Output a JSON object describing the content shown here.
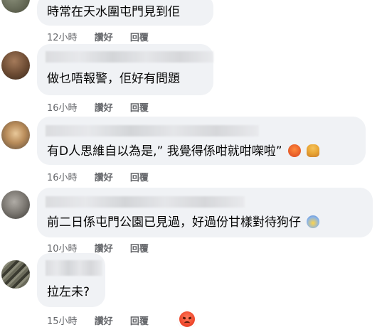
{
  "colors": {
    "bubble_bg": "#f0f2f5",
    "meta_text": "#65676b",
    "body_text": "#050505"
  },
  "comments": [
    {
      "text": "時常在天水圍屯門見到佢",
      "time": "12小時",
      "like": "讚好",
      "reply": "回覆",
      "emojis": []
    },
    {
      "text": "做乜唔報警，佢好有問題",
      "time": "16小時",
      "like": "讚好",
      "reply": "回覆",
      "emojis": []
    },
    {
      "text": "有D人思維自以為是,” 我覺得係咁就咁㗎啦”",
      "time": "16小時",
      "like": "讚好",
      "reply": "回覆",
      "emojis": [
        "cursing-face-emoji",
        "shrugging-person-emoji"
      ]
    },
    {
      "text": "前二日係屯門公園已見過，好過份甘樣對待狗仔",
      "time": "10小時",
      "like": "讚好",
      "reply": "回覆",
      "emojis": [
        "screaming-face-emoji"
      ]
    },
    {
      "text": "拉左未?",
      "time": "15小時",
      "like": "讚好",
      "reply": "回覆",
      "emojis": [],
      "reaction": "angry-reaction-icon"
    }
  ]
}
